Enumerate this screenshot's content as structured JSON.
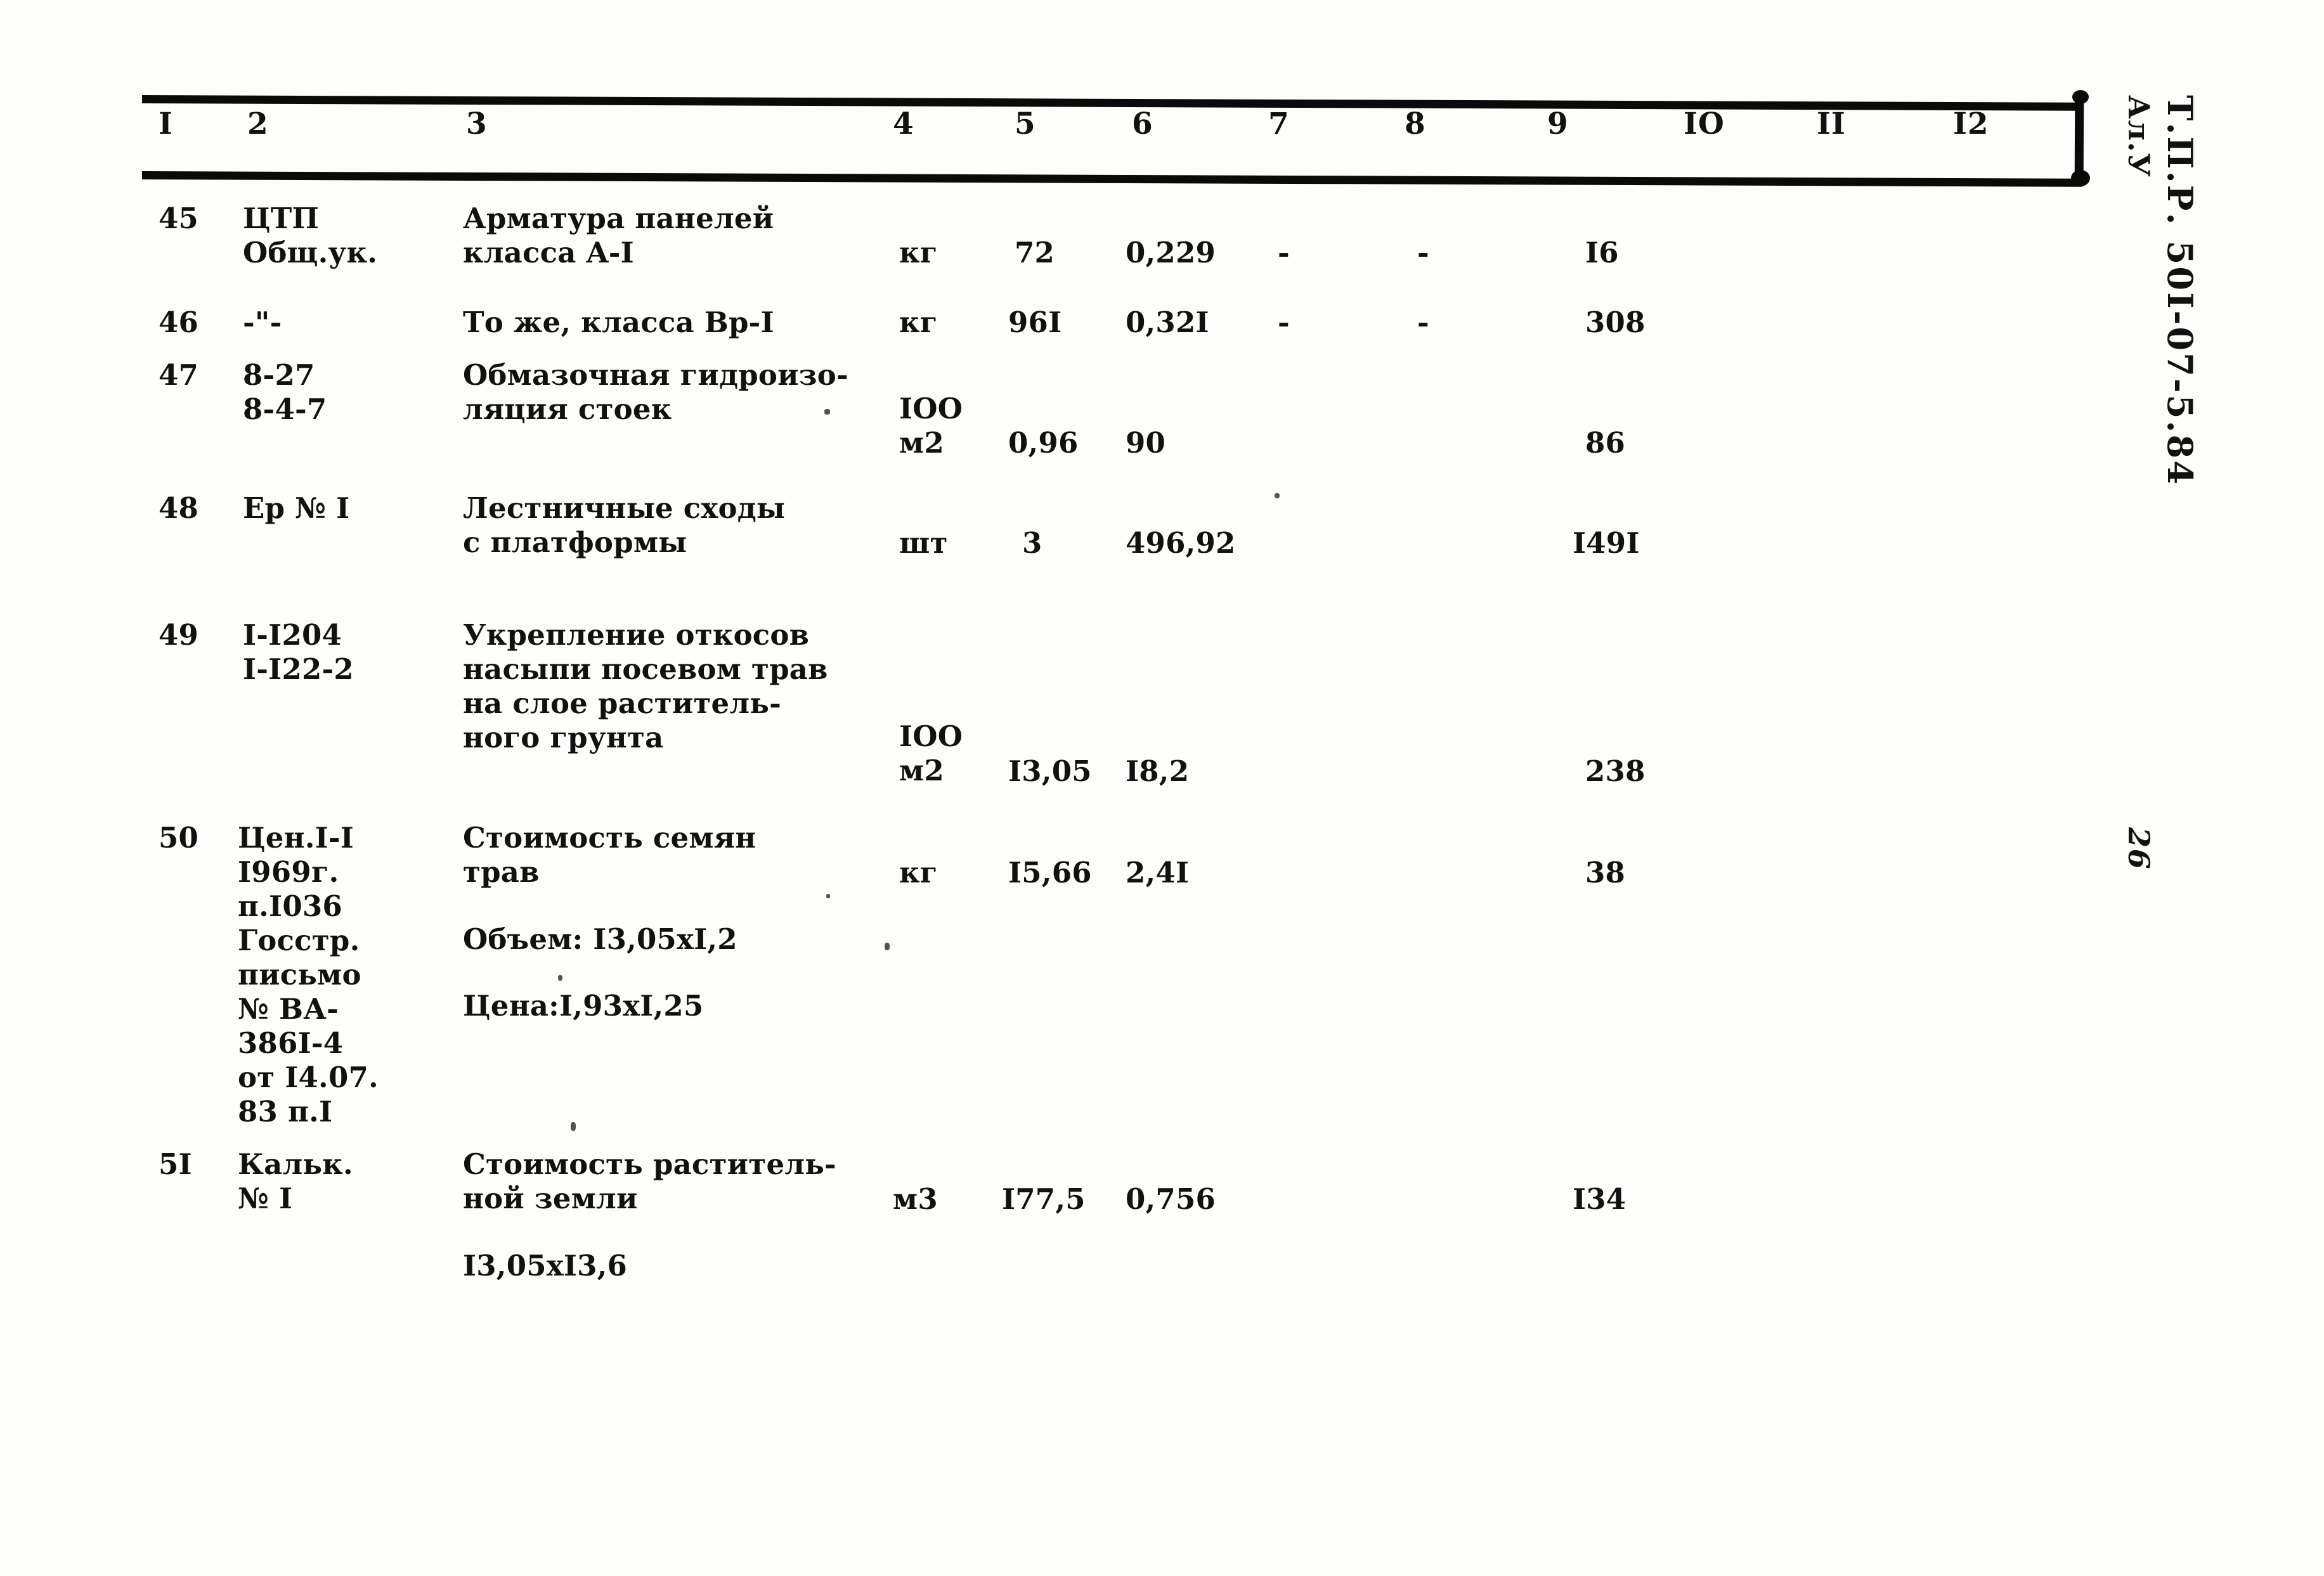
{
  "document": {
    "doc_code": "Т.П.Р. 50I-07-5.84",
    "sheet_code": "Ал.У",
    "page_number": "26"
  },
  "table": {
    "column_headers": [
      "I",
      "2",
      "3",
      "4",
      "5",
      "6",
      "7",
      "8",
      "9",
      "IO",
      "II",
      "I2"
    ],
    "rows": [
      {
        "c1": "45",
        "c2": "ЦТП\nОбщ.ук.",
        "c3": "Арматура панелей\nкласса A-I",
        "c4": "кг",
        "c5": "72",
        "c6": "0,229",
        "c7": "-",
        "c8": "-",
        "c9": "I6"
      },
      {
        "c1": "46",
        "c2": "-\"-",
        "c3": "То же, класса Вр-I",
        "c4": "кг",
        "c5": "96I",
        "c6": "0,32I",
        "c7": "-",
        "c8": "-",
        "c9": "308"
      },
      {
        "c1": "47",
        "c2": "8-27\n8-4-7",
        "c3": "Обмазочная гидроизо-\nляция стоек",
        "c4": "IOO\nм2",
        "c5": "0,96",
        "c6": "90",
        "c7": "",
        "c8": "",
        "c9": "86"
      },
      {
        "c1": "48",
        "c2": "Ер № I",
        "c3": "Лестничные сходы\nс платформы",
        "c4": "шт",
        "c5": "3",
        "c6": "496,92",
        "c7": "",
        "c8": "",
        "c9": "I49I"
      },
      {
        "c1": "49",
        "c2": "I-I204\nI-I22-2",
        "c3": "Укрепление откосов\nнасыпи посевом трав\nна слое раститель-\nного грунта",
        "c4": "IOO\nм2",
        "c5": "I3,05",
        "c6": "I8,2",
        "c7": "",
        "c8": "",
        "c9": "238"
      },
      {
        "c1": "50",
        "c2": "Цен.I-I\nI969г.\nп.I036\nГосстр.\nписьмо\n№ ВА-\n386I-4\nот I4.07.\n83 п.I",
        "c3": "Стоимость семян\nтрав",
        "c3_note1": "Объем: I3,05xI,2",
        "c3_note2": "Цена:I,93xI,25",
        "c4": "кг",
        "c5": "I5,66",
        "c6": "2,4I",
        "c7": "",
        "c8": "",
        "c9": "38"
      },
      {
        "c1": "5I",
        "c2": "Кальк.\n№ I",
        "c3": "Стоимость раститель-\nной земли",
        "c3_note1": "I3,05xI3,6",
        "c4": "м3",
        "c5": "I77,5",
        "c6": "0,756",
        "c7": "",
        "c8": "",
        "c9": "I34"
      }
    ]
  }
}
